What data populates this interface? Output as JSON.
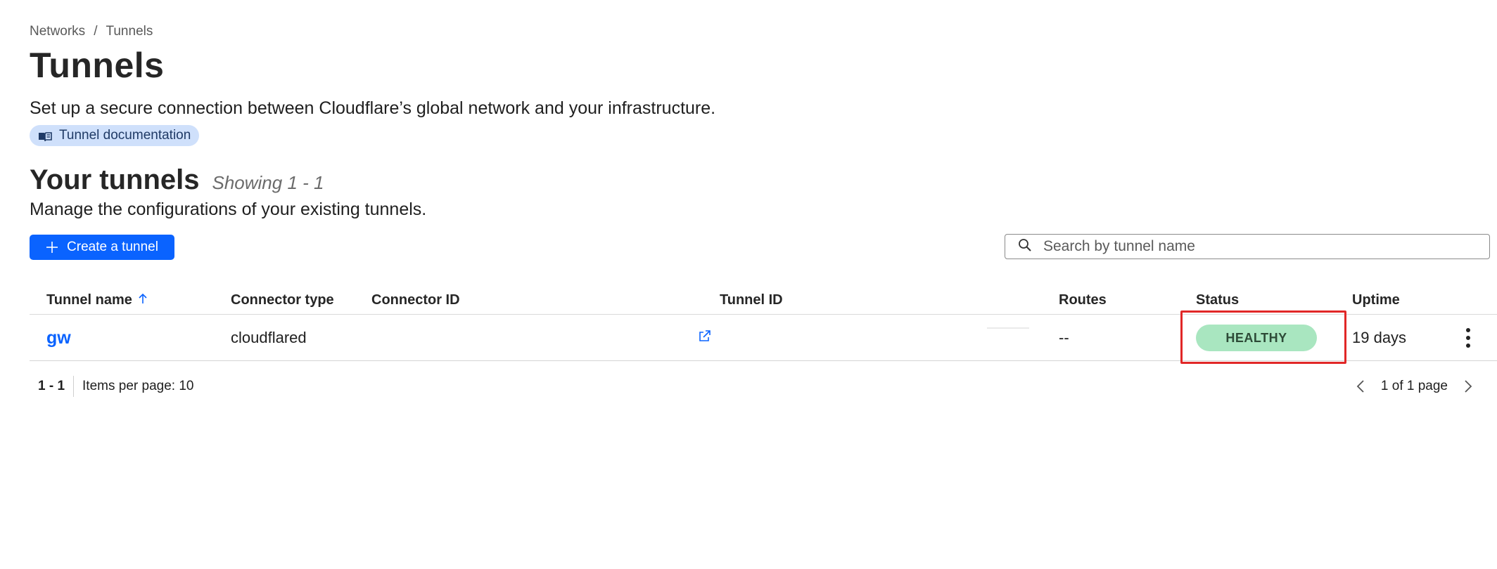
{
  "breadcrumb": {
    "items": [
      "Networks",
      "Tunnels"
    ],
    "separator": "/"
  },
  "page": {
    "title": "Tunnels",
    "description": "Set up a secure connection between Cloudflare’s global network and your infrastructure.",
    "doc_link": "Tunnel documentation"
  },
  "section": {
    "title": "Your tunnels",
    "showing": "Showing 1 - 1",
    "description": "Manage the configurations of your existing tunnels."
  },
  "actions": {
    "create_label": "Create a tunnel"
  },
  "search": {
    "placeholder": "Search by tunnel name",
    "value": ""
  },
  "table": {
    "headers": {
      "name": "Tunnel name",
      "connector_type": "Connector type",
      "connector_id": "Connector ID",
      "tunnel_id": "Tunnel ID",
      "routes": "Routes",
      "status": "Status",
      "uptime": "Uptime"
    },
    "sort": {
      "column": "name",
      "direction": "ascending"
    },
    "rows": [
      {
        "name": "gw",
        "connector_type": "cloudflared",
        "connector_id": "",
        "tunnel_id": "",
        "routes": "--",
        "status": "HEALTHY",
        "uptime": "19 days"
      }
    ]
  },
  "pagination": {
    "range": "1 - 1",
    "items_per_page": "Items per page: 10",
    "page_info": "1 of 1 page"
  },
  "colors": {
    "accent": "#0a63ff",
    "healthy_bg": "#a9e6c0",
    "highlight": "#e12727",
    "doc_pill_bg": "#cfe0fb"
  }
}
